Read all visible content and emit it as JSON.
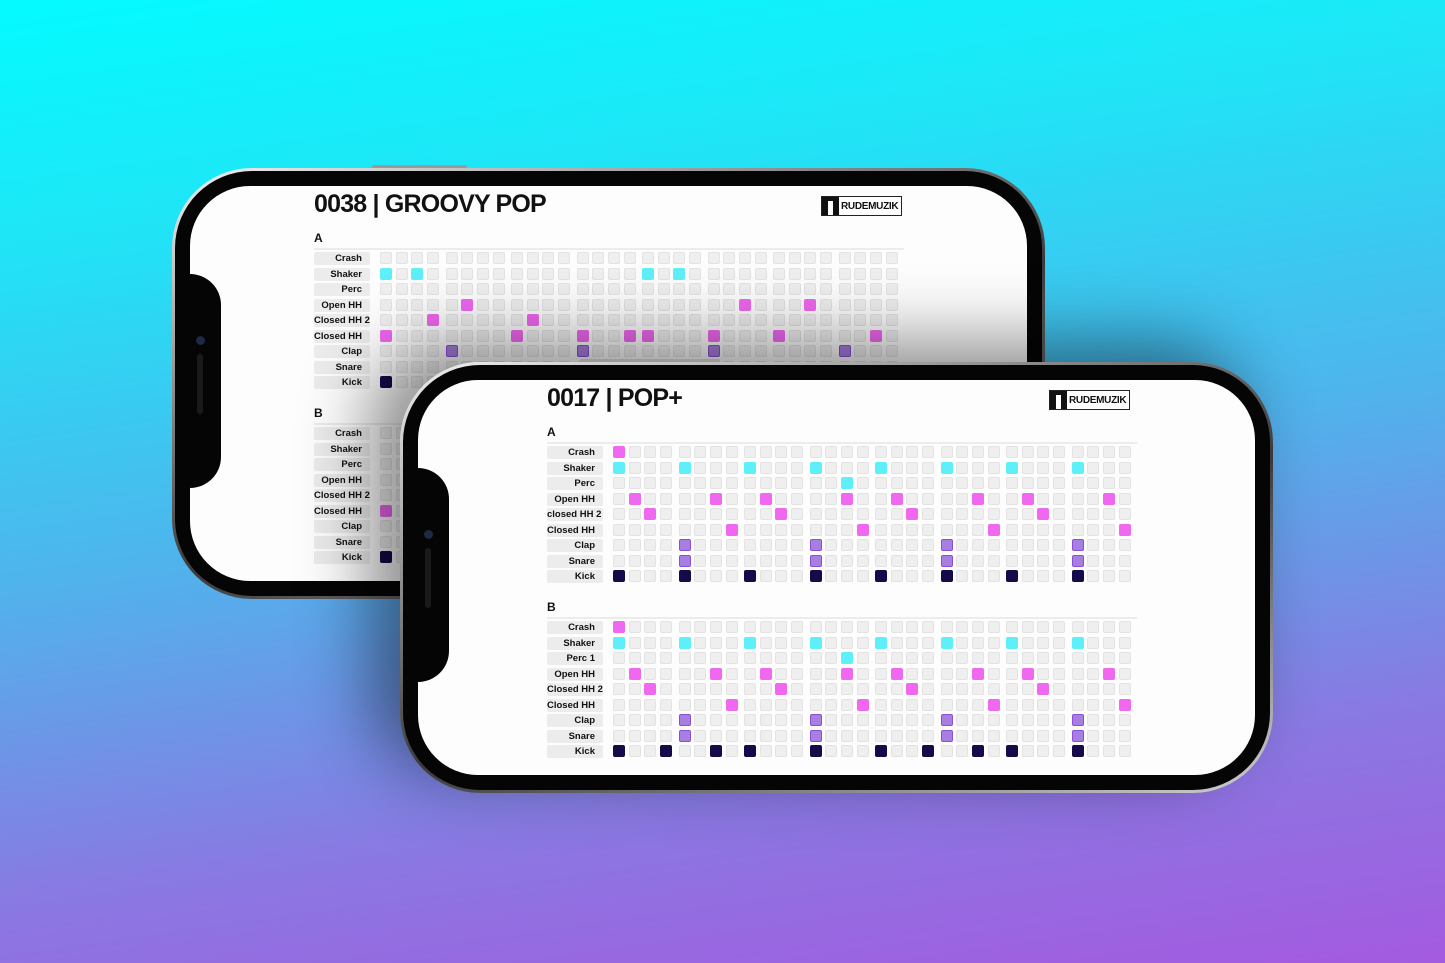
{
  "colors": {
    "background_top": "#03fbff",
    "background_bottom": "#a45ae0",
    "pink": "#f067f0",
    "cyan": "#5ef0fa",
    "purple": "#a77fe0",
    "kick": "#150a4a",
    "empty": "#efefef"
  },
  "phones": [
    {
      "title": "0038 | GROOVY POP",
      "logo": "RUDEMUZIK",
      "sections": [
        {
          "label": "A",
          "rows": [
            {
              "name": "Crash",
              "color": "pink",
              "steps": []
            },
            {
              "name": "Shaker",
              "color": "cyan",
              "steps": [
                0,
                2,
                16,
                18
              ]
            },
            {
              "name": "Perc",
              "color": "cyan",
              "steps": []
            },
            {
              "name": "Open HH",
              "color": "pink",
              "steps": [
                5,
                22,
                26
              ]
            },
            {
              "name": "Closed HH 2",
              "color": "pink",
              "steps": [
                3,
                9
              ]
            },
            {
              "name": "Closed HH",
              "color": "pink",
              "steps": [
                0,
                8,
                12,
                15,
                16,
                20,
                24,
                30
              ]
            },
            {
              "name": "Clap",
              "color": "purple",
              "steps": [
                4,
                12,
                20,
                28
              ]
            },
            {
              "name": "Snare",
              "color": "purple",
              "steps": []
            },
            {
              "name": "Kick",
              "color": "kick",
              "steps": [
                0
              ]
            }
          ]
        },
        {
          "label": "B",
          "rows": [
            {
              "name": "Crash",
              "color": "pink",
              "steps": []
            },
            {
              "name": "Shaker",
              "color": "cyan",
              "steps": []
            },
            {
              "name": "Perc",
              "color": "cyan",
              "steps": []
            },
            {
              "name": "Open HH",
              "color": "pink",
              "steps": []
            },
            {
              "name": "Closed HH 2",
              "color": "pink",
              "steps": []
            },
            {
              "name": "Closed HH",
              "color": "pink",
              "steps": [
                0
              ]
            },
            {
              "name": "Clap",
              "color": "purple",
              "steps": []
            },
            {
              "name": "Snare",
              "color": "purple",
              "steps": []
            },
            {
              "name": "Kick",
              "color": "kick",
              "steps": [
                0
              ]
            }
          ]
        }
      ]
    },
    {
      "title": "0017 | POP+",
      "logo": "RUDEMUZIK",
      "sections": [
        {
          "label": "A",
          "rows": [
            {
              "name": "Crash",
              "color": "pink",
              "steps": [
                0
              ]
            },
            {
              "name": "Shaker",
              "color": "cyan",
              "steps": [
                0,
                4,
                8,
                12,
                16,
                20,
                24,
                28
              ]
            },
            {
              "name": "Perc",
              "color": "cyan",
              "steps": [
                14
              ]
            },
            {
              "name": "Open HH",
              "color": "pink",
              "steps": [
                1,
                6,
                9,
                14,
                17,
                22,
                25,
                30
              ]
            },
            {
              "name": "closed HH 2",
              "color": "pink",
              "steps": [
                2,
                10,
                18,
                26
              ]
            },
            {
              "name": "Closed HH",
              "color": "pink",
              "steps": [
                7,
                15,
                23,
                31
              ]
            },
            {
              "name": "Clap",
              "color": "purple",
              "steps": [
                4,
                12,
                20,
                28
              ]
            },
            {
              "name": "Snare",
              "color": "purple",
              "steps": [
                4,
                12,
                20,
                28
              ]
            },
            {
              "name": "Kick",
              "color": "kick",
              "steps": [
                0,
                4,
                8,
                12,
                16,
                20,
                24,
                28
              ]
            }
          ]
        },
        {
          "label": "B",
          "rows": [
            {
              "name": "Crash",
              "color": "pink",
              "steps": [
                0
              ]
            },
            {
              "name": "Shaker",
              "color": "cyan",
              "steps": [
                0,
                4,
                8,
                12,
                16,
                20,
                24,
                28
              ]
            },
            {
              "name": "Perc 1",
              "color": "cyan",
              "steps": [
                14
              ]
            },
            {
              "name": "Open HH",
              "color": "pink",
              "steps": [
                1,
                6,
                9,
                14,
                17,
                22,
                25,
                30
              ]
            },
            {
              "name": "Closed HH 2",
              "color": "pink",
              "steps": [
                2,
                10,
                18,
                26
              ]
            },
            {
              "name": "Closed HH",
              "color": "pink",
              "steps": [
                7,
                15,
                23,
                31
              ]
            },
            {
              "name": "Clap",
              "color": "purple",
              "steps": [
                4,
                12,
                20,
                28
              ]
            },
            {
              "name": "Snare",
              "color": "purple",
              "steps": [
                4,
                12,
                20,
                28
              ]
            },
            {
              "name": "Kick",
              "color": "kick",
              "steps": [
                0,
                3,
                6,
                8,
                12,
                16,
                19,
                22,
                24,
                28
              ]
            }
          ]
        }
      ]
    }
  ]
}
